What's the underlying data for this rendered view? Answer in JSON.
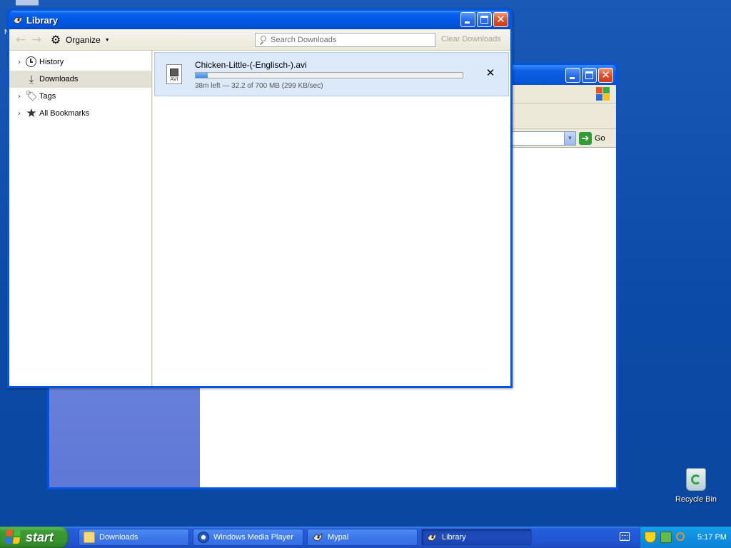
{
  "desktop": {
    "top_letter": "N",
    "recycle_bin_label": "Recycle Bin"
  },
  "background_window": {
    "go_label": "Go"
  },
  "library": {
    "title": "Library",
    "toolbar": {
      "organize_label": "Organize",
      "search_placeholder": "Search Downloads",
      "clear_downloads_label": "Clear Downloads"
    },
    "sidebar": {
      "items": [
        {
          "label": "History",
          "icon": "clock-icon",
          "expandable": true
        },
        {
          "label": "Downloads",
          "icon": "download-arrow-icon",
          "expandable": false,
          "selected": true
        },
        {
          "label": "Tags",
          "icon": "tag-icon",
          "expandable": true
        },
        {
          "label": "All Bookmarks",
          "icon": "star-icon",
          "expandable": true
        }
      ]
    },
    "downloads": [
      {
        "file_name": "Chicken-Little-(-Englisch-).avi",
        "file_type": "AVI",
        "status": "38m left — 32.2 of 700 MB (299 KB/sec)",
        "progress_fraction": 0.046
      }
    ]
  },
  "taskbar": {
    "start_label": "start",
    "buttons": [
      {
        "label": "Downloads",
        "icon": "folder-icon"
      },
      {
        "label": "Windows Media Player",
        "icon": "media-player-icon"
      },
      {
        "label": "Mypal",
        "icon": "mypal-icon"
      },
      {
        "label": "Library",
        "icon": "mypal-icon",
        "active": true
      }
    ],
    "clock": "5:17 PM"
  },
  "colors": {
    "desktop_blue": "#0d4da1",
    "titlebar_blue": "#0058e6",
    "close_red": "#e0502a",
    "progress_blue": "#3b88e8",
    "selected_row": "#e3e1d6",
    "download_item_bg": "#dbe9f8"
  }
}
